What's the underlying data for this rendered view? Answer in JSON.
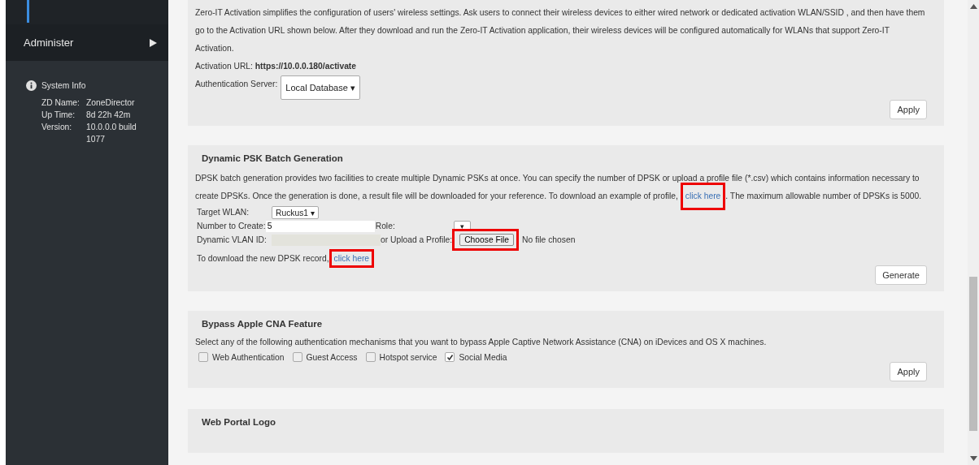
{
  "sidebar": {
    "menu_item": {
      "label": "Administer"
    },
    "system_info": {
      "title": "System Info",
      "rows": [
        {
          "label": "ZD Name:",
          "value": "ZoneDirector"
        },
        {
          "label": "Up Time:",
          "value": "8d 22h 42m"
        },
        {
          "label": "Version:",
          "value": "10.0.0.0 build 1077"
        }
      ]
    }
  },
  "zero_it": {
    "description": "Zero-IT Activation simplifies the configuration of users' wireless settings. Ask users to connect their wireless devices to either wired network or dedicated activation WLAN/SSID , and then have them go to the Activation URL shown below. After they download and run the Zero-IT Activation application, their wireless devices will be configured automatically for WLANs that support Zero-IT Activation.",
    "activation_url": "Activation URL: **https://10.0.0.180/activate**",
    "auth_server_label": "Authentication Server:",
    "auth_server_value": "Local Database ▾",
    "apply": "Apply"
  },
  "dpsk": {
    "title": "Dynamic PSK Batch Generation",
    "description_before": "DPSK batch generation provides two facilities to create multiple Dynamic PSKs at once. You can specify the number of DPSK or upload a profile file (*.csv) which contains information necessary to create DPSKs. Once the generation is done, a result file will be downloaded for your reference. To download an example of profile,",
    "example_link": {
      "label": "click here",
      "highlighted": true
    },
    "description_after": ". The maximum allowable number of DPSKs is 5000.",
    "target_wlan_label": "Target WLAN:",
    "target_wlan_value": "Ruckus1 ▾",
    "number_label": "Number to Create:",
    "number_value": "5",
    "role_label": "Role:",
    "role_value": "▾",
    "vlan_label": "Dynamic VLAN ID:",
    "vlan_disabled": true,
    "upload_label": "or Upload a Profile:",
    "choose_file": {
      "label": "Choose File",
      "highlighted": true
    },
    "no_file": "No file chosen",
    "download_text": "To download the new DPSK record,",
    "download_link": {
      "label": "click here",
      "highlighted": true
    },
    "generate": "Generate"
  },
  "cna": {
    "title": "Bypass Apple CNA Feature",
    "description": "Select any of the following authentication mechanisms that you want to bypass Apple Captive Network Assistance (CNA) on iDevices and OS X machines.",
    "options": [
      {
        "label": "Web Authentication",
        "checked": false
      },
      {
        "label": "Guest Access",
        "checked": false
      },
      {
        "label": "Hotspot service",
        "checked": false
      },
      {
        "label": "Social Media",
        "checked": true
      }
    ],
    "apply": "Apply"
  },
  "web_portal_logo": {
    "title": "Web Portal Logo"
  }
}
